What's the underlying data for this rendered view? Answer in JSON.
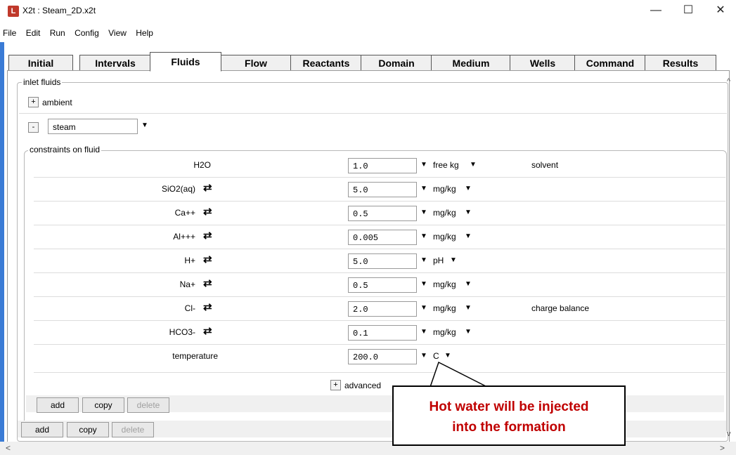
{
  "window": {
    "app_icon": "L",
    "title": "X2t : Steam_2D.x2t",
    "minimize": "—",
    "maximize": "☐",
    "close": "✕"
  },
  "menu": [
    "File",
    "Edit",
    "Run",
    "Config",
    "View",
    "Help"
  ],
  "tabs": [
    "Initial",
    "Intervals",
    "Fluids",
    "Flow",
    "Reactants",
    "Domain",
    "Medium",
    "Wells",
    "Command",
    "Results"
  ],
  "active_tab": "Fluids",
  "inlet": {
    "legend": "inlet fluids",
    "ambient": {
      "toggle": "+",
      "label": "ambient"
    },
    "steam": {
      "toggle": "-",
      "name": "steam"
    },
    "constraints_legend": "constraints on fluid",
    "rows": [
      {
        "species": "H2O",
        "value": "1.0",
        "unit": "free kg",
        "note": "solvent"
      },
      {
        "species": "SiO2(aq)",
        "value": "5.0",
        "unit": "mg/kg",
        "note": ""
      },
      {
        "species": "Ca++",
        "value": "0.5",
        "unit": "mg/kg",
        "note": ""
      },
      {
        "species": "Al+++",
        "value": "0.005",
        "unit": "mg/kg",
        "note": ""
      },
      {
        "species": "H+",
        "value": "5.0",
        "unit": "pH",
        "note": ""
      },
      {
        "species": "Na+",
        "value": "0.5",
        "unit": "mg/kg",
        "note": ""
      },
      {
        "species": "Cl-",
        "value": "2.0",
        "unit": "mg/kg",
        "note": "charge balance"
      },
      {
        "species": "HCO3-",
        "value": "0.1",
        "unit": "mg/kg",
        "note": ""
      },
      {
        "species": "temperature",
        "value": "200.0",
        "unit": "C",
        "note": ""
      }
    ],
    "advanced": {
      "toggle": "+",
      "label": "advanced"
    },
    "inner_buttons": {
      "add": "add",
      "copy": "copy",
      "delete": "delete"
    },
    "outer_buttons": {
      "add": "add",
      "copy": "copy",
      "delete": "delete"
    }
  },
  "callout": {
    "line1": "Hot water will be injected",
    "line2": "into the formation"
  },
  "scroll": {
    "left": "<",
    "right": ">",
    "up": "^",
    "down": "v"
  },
  "icons": {
    "swap": "swap-arrows-icon",
    "dropdown": "dropdown-arrow-icon"
  }
}
